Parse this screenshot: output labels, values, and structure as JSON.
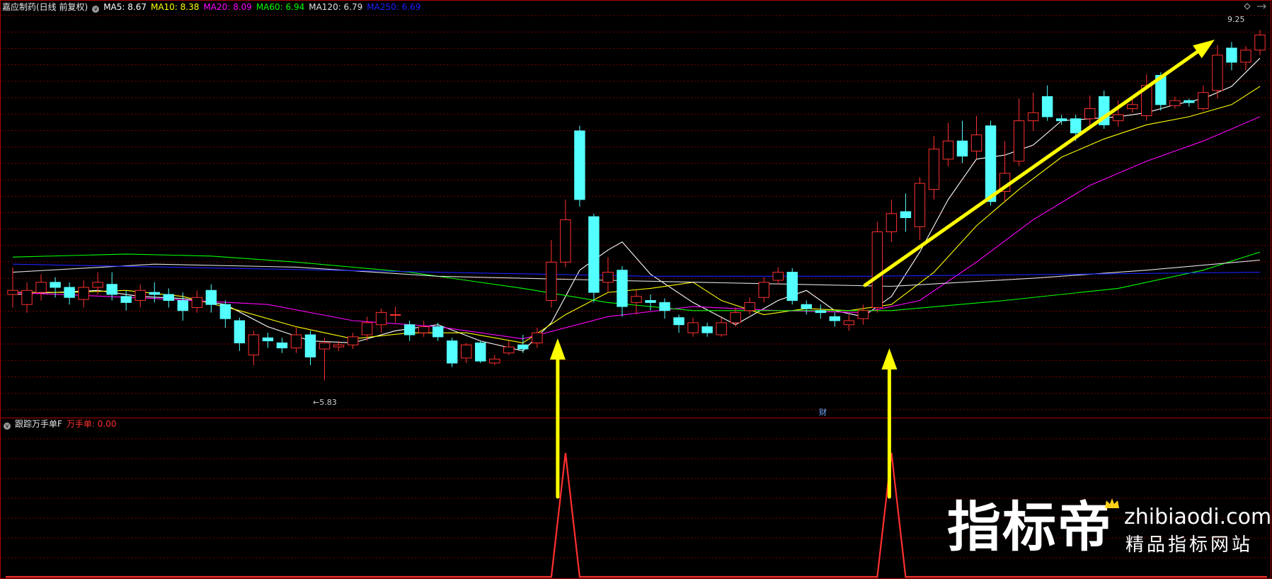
{
  "main_panel": {
    "stock_title": "嘉应制药(日线 前复权)",
    "ma_legend": [
      {
        "label": "MA5: 8.67",
        "color": "#ffffff"
      },
      {
        "label": "MA10: 8.38",
        "color": "#ffff00"
      },
      {
        "label": "MA20: 8.09",
        "color": "#ff00ff"
      },
      {
        "label": "MA60: 6.94",
        "color": "#00ff00"
      },
      {
        "label": "MA120: 6.79",
        "color": "#e0e0e0"
      },
      {
        "label": "MA250: 6.69",
        "color": "#2020ff"
      }
    ],
    "high_marker": "9.25",
    "low_marker": "←5.83",
    "event_marker": "财"
  },
  "sub_panel": {
    "indicator_name": "跟踪万手单F",
    "value_label": "万手单: 0.00"
  },
  "watermark": {
    "brand": "指标帝",
    "site": "zhibiaodi.com",
    "slogan": "精品指标网站"
  },
  "colors": {
    "up": "#ff3030",
    "down": "#54ffff",
    "arrow": "#ffff00",
    "grid": "#7a0000",
    "border": "#aa0000"
  },
  "chart_data": {
    "type": "candlestick",
    "y_range": [
      5.6,
      9.4
    ],
    "candles": [
      [
        6.68,
        6.72,
        6.95,
        6.55
      ],
      [
        6.58,
        6.72,
        6.8,
        6.5
      ],
      [
        6.7,
        6.8,
        6.88,
        6.62
      ],
      [
        6.8,
        6.75,
        6.85,
        6.65
      ],
      [
        6.75,
        6.65,
        6.8,
        6.58
      ],
      [
        6.63,
        6.75,
        6.82,
        6.55
      ],
      [
        6.75,
        6.8,
        6.9,
        6.68
      ],
      [
        6.78,
        6.68,
        6.9,
        6.62
      ],
      [
        6.66,
        6.6,
        6.72,
        6.52
      ],
      [
        6.62,
        6.72,
        6.78,
        6.55
      ],
      [
        6.7,
        6.68,
        6.8,
        6.6
      ],
      [
        6.68,
        6.62,
        6.74,
        6.55
      ],
      [
        6.62,
        6.52,
        6.7,
        6.42
      ],
      [
        6.55,
        6.65,
        6.72,
        6.5
      ],
      [
        6.72,
        6.58,
        6.78,
        6.5
      ],
      [
        6.58,
        6.44,
        6.62,
        6.35
      ],
      [
        6.42,
        6.2,
        6.45,
        6.12
      ],
      [
        6.08,
        6.28,
        6.32,
        5.98
      ],
      [
        6.25,
        6.22,
        6.3,
        6.15
      ],
      [
        6.2,
        6.15,
        6.25,
        6.1
      ],
      [
        6.15,
        6.28,
        6.35,
        6.1
      ],
      [
        6.28,
        6.06,
        6.32,
        5.98
      ],
      [
        6.14,
        6.2,
        6.25,
        5.83
      ],
      [
        6.16,
        6.18,
        6.22,
        6.12
      ],
      [
        6.18,
        6.26,
        6.3,
        6.14
      ],
      [
        6.28,
        6.4,
        6.46,
        6.22
      ],
      [
        6.38,
        6.5,
        6.54,
        6.3
      ],
      [
        6.48,
        6.48,
        6.56,
        6.4
      ],
      [
        6.38,
        6.28,
        6.42,
        6.22
      ],
      [
        6.3,
        6.36,
        6.42,
        6.26
      ],
      [
        6.36,
        6.26,
        6.4,
        6.22
      ],
      [
        6.22,
        6.0,
        6.25,
        5.96
      ],
      [
        6.05,
        6.18,
        6.2,
        6.0
      ],
      [
        6.2,
        6.02,
        6.22,
        6.0
      ],
      [
        6.0,
        6.04,
        6.08,
        5.98
      ],
      [
        6.1,
        6.16,
        6.22,
        6.08
      ],
      [
        6.18,
        6.14,
        6.28,
        6.1
      ],
      [
        6.2,
        6.3,
        6.35,
        6.15
      ],
      [
        6.62,
        7.0,
        7.22,
        6.55
      ],
      [
        7.0,
        7.42,
        7.62,
        6.95
      ],
      [
        8.3,
        7.62,
        8.35,
        7.55
      ],
      [
        7.45,
        6.7,
        7.48,
        6.6
      ],
      [
        6.8,
        6.9,
        7.05,
        6.7
      ],
      [
        6.92,
        6.56,
        6.96,
        6.46
      ],
      [
        6.6,
        6.66,
        6.72,
        6.48
      ],
      [
        6.62,
        6.6,
        6.68,
        6.52
      ],
      [
        6.6,
        6.52,
        6.64,
        6.44
      ],
      [
        6.45,
        6.38,
        6.48,
        6.3
      ],
      [
        6.3,
        6.4,
        6.45,
        6.26
      ],
      [
        6.36,
        6.3,
        6.4,
        6.26
      ],
      [
        6.28,
        6.4,
        6.45,
        6.26
      ],
      [
        6.4,
        6.5,
        6.55,
        6.36
      ],
      [
        6.52,
        6.6,
        6.65,
        6.48
      ],
      [
        6.65,
        6.8,
        6.85,
        6.6
      ],
      [
        6.82,
        6.9,
        6.95,
        6.78
      ],
      [
        6.9,
        6.62,
        6.94,
        6.58
      ],
      [
        6.58,
        6.54,
        6.62,
        6.48
      ],
      [
        6.52,
        6.5,
        6.58,
        6.44
      ],
      [
        6.46,
        6.42,
        6.5,
        6.36
      ],
      [
        6.38,
        6.42,
        6.48,
        6.32
      ],
      [
        6.44,
        6.52,
        6.58,
        6.38
      ],
      [
        6.55,
        7.3,
        7.4,
        6.5
      ],
      [
        7.3,
        7.48,
        7.62,
        7.2
      ],
      [
        7.5,
        7.44,
        7.68,
        7.3
      ],
      [
        7.35,
        7.78,
        7.84,
        7.22
      ],
      [
        7.72,
        8.12,
        8.25,
        7.62
      ],
      [
        8.02,
        8.2,
        8.38,
        7.95
      ],
      [
        8.2,
        8.05,
        8.4,
        7.98
      ],
      [
        8.1,
        8.26,
        8.45,
        8.02
      ],
      [
        8.35,
        7.6,
        8.4,
        7.56
      ],
      [
        7.7,
        7.88,
        8.2,
        7.6
      ],
      [
        8.0,
        8.4,
        8.62,
        7.95
      ],
      [
        8.4,
        8.48,
        8.68,
        8.3
      ],
      [
        8.64,
        8.44,
        8.75,
        8.4
      ],
      [
        8.42,
        8.4,
        8.46,
        8.36
      ],
      [
        8.42,
        8.28,
        8.46,
        8.2
      ],
      [
        8.42,
        8.52,
        8.65,
        8.32
      ],
      [
        8.64,
        8.36,
        8.7,
        8.32
      ],
      [
        8.4,
        8.46,
        8.6,
        8.34
      ],
      [
        8.52,
        8.56,
        8.62,
        8.48
      ],
      [
        8.45,
        8.75,
        8.86,
        8.4
      ],
      [
        8.85,
        8.56,
        8.88,
        8.5
      ],
      [
        8.55,
        8.6,
        8.64,
        8.52
      ],
      [
        8.6,
        8.58,
        8.62,
        8.54
      ],
      [
        8.52,
        8.68,
        8.75,
        8.5
      ],
      [
        8.7,
        9.05,
        9.15,
        8.62
      ],
      [
        9.12,
        8.98,
        9.18,
        8.9
      ],
      [
        8.98,
        9.1,
        9.14,
        8.9
      ],
      [
        9.1,
        9.25,
        9.3,
        9.05
      ]
    ],
    "ma": [
      {
        "name": "MA5",
        "color": "#ffffff",
        "points": [
          [
            0,
            6.68
          ],
          [
            3,
            6.7
          ],
          [
            6,
            6.72
          ],
          [
            9,
            6.66
          ],
          [
            12,
            6.64
          ],
          [
            15,
            6.58
          ],
          [
            18,
            6.36
          ],
          [
            21,
            6.22
          ],
          [
            24,
            6.2
          ],
          [
            27,
            6.32
          ],
          [
            30,
            6.38
          ],
          [
            33,
            6.22
          ],
          [
            36,
            6.12
          ],
          [
            38,
            6.4
          ],
          [
            40,
            6.92
          ],
          [
            42,
            7.12
          ],
          [
            43,
            7.2
          ],
          [
            45,
            6.88
          ],
          [
            48,
            6.6
          ],
          [
            51,
            6.38
          ],
          [
            54,
            6.62
          ],
          [
            56,
            6.72
          ],
          [
            58,
            6.52
          ],
          [
            60,
            6.46
          ],
          [
            62,
            6.66
          ],
          [
            64,
            7.1
          ],
          [
            66,
            7.62
          ],
          [
            68,
            8.02
          ],
          [
            70,
            8.06
          ],
          [
            72,
            8.16
          ],
          [
            74,
            8.4
          ],
          [
            76,
            8.42
          ],
          [
            78,
            8.44
          ],
          [
            80,
            8.48
          ],
          [
            82,
            8.56
          ],
          [
            84,
            8.62
          ],
          [
            86,
            8.74
          ],
          [
            88,
            9.02
          ]
        ]
      },
      {
        "name": "MA10",
        "color": "#ffff00",
        "points": [
          [
            0,
            6.7
          ],
          [
            4,
            6.7
          ],
          [
            8,
            6.72
          ],
          [
            12,
            6.66
          ],
          [
            16,
            6.52
          ],
          [
            20,
            6.36
          ],
          [
            24,
            6.24
          ],
          [
            28,
            6.3
          ],
          [
            32,
            6.3
          ],
          [
            36,
            6.2
          ],
          [
            39,
            6.48
          ],
          [
            42,
            6.7
          ],
          [
            45,
            6.74
          ],
          [
            48,
            6.8
          ],
          [
            50,
            6.62
          ],
          [
            53,
            6.48
          ],
          [
            56,
            6.54
          ],
          [
            59,
            6.52
          ],
          [
            62,
            6.58
          ],
          [
            65,
            6.9
          ],
          [
            68,
            7.36
          ],
          [
            71,
            7.72
          ],
          [
            74,
            8.04
          ],
          [
            77,
            8.22
          ],
          [
            80,
            8.36
          ],
          [
            83,
            8.44
          ],
          [
            86,
            8.56
          ],
          [
            88,
            8.74
          ]
        ]
      },
      {
        "name": "MA20",
        "color": "#ff00ff",
        "points": [
          [
            0,
            6.7
          ],
          [
            10,
            6.64
          ],
          [
            18,
            6.58
          ],
          [
            24,
            6.42
          ],
          [
            30,
            6.36
          ],
          [
            36,
            6.24
          ],
          [
            42,
            6.46
          ],
          [
            48,
            6.56
          ],
          [
            54,
            6.52
          ],
          [
            60,
            6.5
          ],
          [
            64,
            6.62
          ],
          [
            68,
            7.0
          ],
          [
            72,
            7.42
          ],
          [
            76,
            7.76
          ],
          [
            80,
            8.0
          ],
          [
            84,
            8.2
          ],
          [
            88,
            8.44
          ]
        ]
      },
      {
        "name": "MA60",
        "color": "#00ff00",
        "points": [
          [
            0,
            7.05
          ],
          [
            8,
            7.08
          ],
          [
            14,
            7.06
          ],
          [
            20,
            7.0
          ],
          [
            28,
            6.9
          ],
          [
            36,
            6.74
          ],
          [
            42,
            6.6
          ],
          [
            48,
            6.52
          ],
          [
            56,
            6.52
          ],
          [
            62,
            6.52
          ],
          [
            70,
            6.62
          ],
          [
            78,
            6.74
          ],
          [
            84,
            6.92
          ],
          [
            88,
            7.1
          ]
        ]
      },
      {
        "name": "MA120",
        "color": "#e0e0e0",
        "points": [
          [
            0,
            6.9
          ],
          [
            10,
            6.98
          ],
          [
            20,
            6.95
          ],
          [
            30,
            6.86
          ],
          [
            42,
            6.82
          ],
          [
            52,
            6.79
          ],
          [
            62,
            6.76
          ],
          [
            72,
            6.84
          ],
          [
            80,
            6.92
          ],
          [
            88,
            7.02
          ]
        ]
      },
      {
        "name": "MA250",
        "color": "#2020ff",
        "points": [
          [
            0,
            6.98
          ],
          [
            15,
            6.94
          ],
          [
            30,
            6.9
          ],
          [
            45,
            6.86
          ],
          [
            60,
            6.86
          ],
          [
            75,
            6.88
          ],
          [
            88,
            6.9
          ]
        ]
      }
    ],
    "sub_y_range": [
      0,
      1
    ],
    "indicator_spikes": [
      {
        "index": 39,
        "value": 1.0
      },
      {
        "index": 62,
        "value": 1.0
      }
    ]
  }
}
